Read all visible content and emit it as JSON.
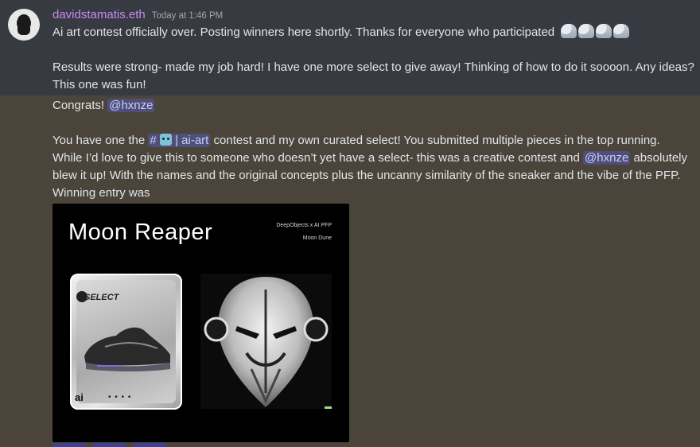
{
  "message": {
    "username": "davidstamatis.eth",
    "timestamp": "Today at 1:46 PM",
    "lines": {
      "l1": "Ai art contest officially over. Posting winners here shortly. Thanks for everyone who participated",
      "l2": "Results were strong- made my job hard! I have one more select to give away! Thinking of how to do it soooon. Any ideas?",
      "l3": "This one was fun!",
      "l4_prefix": "Congrats!",
      "mention1": "@hxnze",
      "l5_prefix": "You have one the",
      "channel_hash": "#",
      "channel_name": "| ai-art",
      "l5_suffix": "contest and my own curated select! You submitted multiple pieces in the top running.",
      "l6_prefix": "While I’d love to give this to someone who doesn’t yet have a select- this was a creative contest and",
      "mention2": "@hxnze",
      "l6_suffix": "absolutely",
      "l7": "blew it up! With the names and the original concepts plus the uncanny similarity of the sneaker and the vibe of the PFP.",
      "l8": "Winning entry was"
    },
    "emoji": [
      "flexed-biceps",
      "flexed-biceps",
      "flexed-biceps",
      "flexed-biceps"
    ]
  },
  "embed": {
    "title": "Moon Reaper",
    "meta_line1": "DeepObjects x AI PFP",
    "meta_line2": "Moon Dune",
    "card_brand": "SELECT",
    "card_bottom": "ai",
    "card_dots": "• • • •"
  },
  "colors": {
    "username": "#c98cf5",
    "mention_bg": "#5865f2",
    "background": "#4a443b",
    "highlight_bg": "#373a40"
  }
}
